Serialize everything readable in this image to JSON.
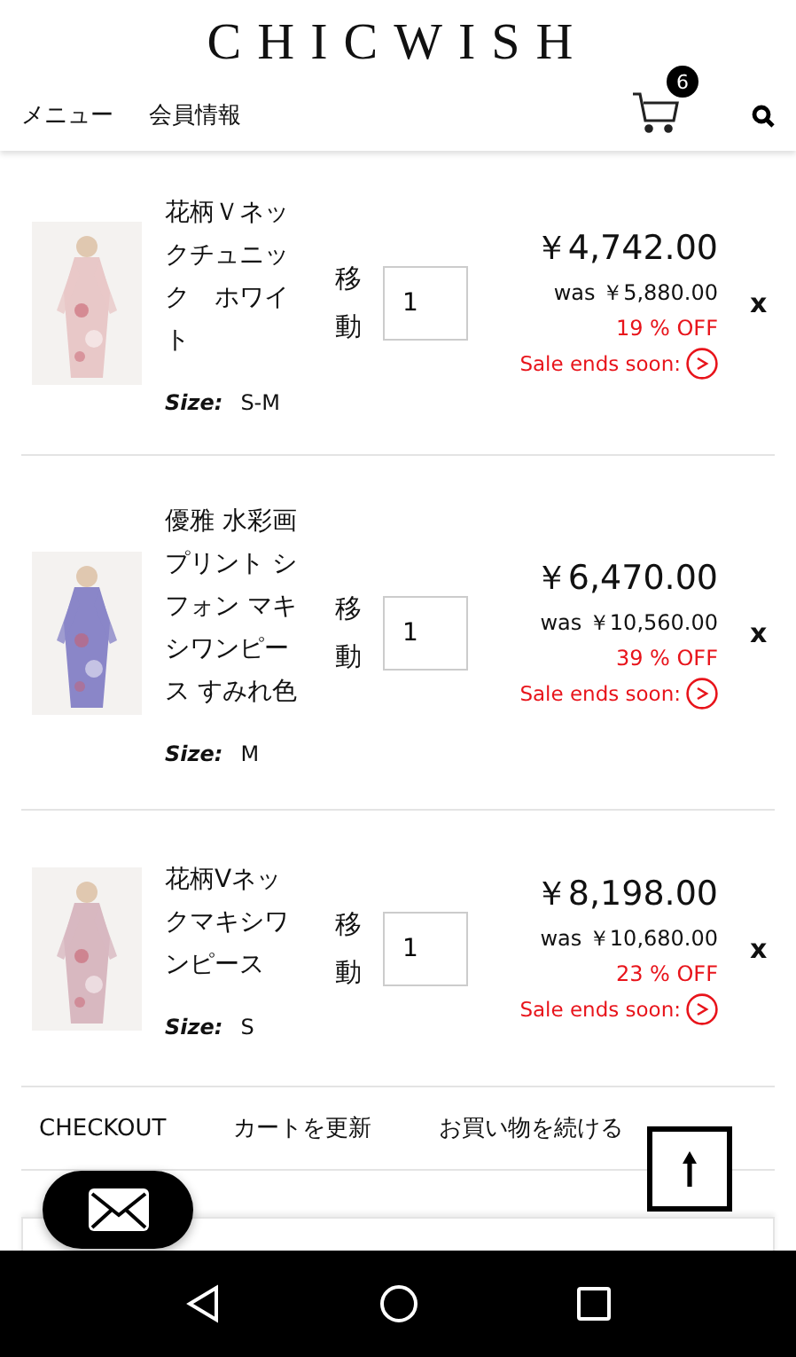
{
  "header": {
    "logo": "CHICWISH",
    "nav": [
      "メニュー",
      "会員情報"
    ],
    "cart_count": "6"
  },
  "items": [
    {
      "name": "花柄Ｖネックチュニック　ホワイト",
      "size_label": "Size:",
      "size": "S-M",
      "move": "移動",
      "quantity": "1",
      "price": "￥4,742.00",
      "was": "was ￥5,880.00",
      "discount": "19 % OFF",
      "sale": "Sale ends soon:",
      "remove": "x"
    },
    {
      "name": "優雅 水彩画プリント シフォン マキシワンピース すみれ色",
      "size_label": "Size:",
      "size": "M",
      "move": "移動",
      "quantity": "1",
      "price": "￥6,470.00",
      "was": "was ￥10,560.00",
      "discount": "39 % OFF",
      "sale": "Sale ends soon:",
      "remove": "x"
    },
    {
      "name": "花柄Vネックマキシワンピース",
      "size_label": "Size:",
      "size": "S",
      "move": "移動",
      "quantity": "1",
      "price": "￥8,198.00",
      "was": "was ￥10,680.00",
      "discount": "23 % OFF",
      "sale": "Sale ends soon:",
      "remove": "x"
    }
  ],
  "actions": [
    "CHECKOUT",
    "カートを更新",
    "お買い物を続ける"
  ]
}
